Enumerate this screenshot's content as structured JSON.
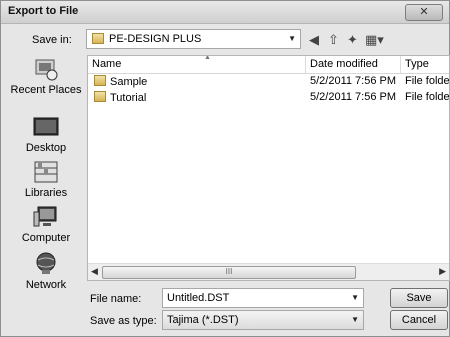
{
  "window": {
    "title": "Export to File",
    "close_label": "✕"
  },
  "toolbar": {
    "save_in_label": "Save in:",
    "save_in_value": "PE-DESIGN PLUS",
    "icons": [
      "back-icon",
      "up-folder-icon",
      "new-folder-icon",
      "view-menu-icon"
    ]
  },
  "places": [
    {
      "label": "Recent Places",
      "icon": "recent-places-icon"
    },
    {
      "label": "Desktop",
      "icon": "desktop-icon"
    },
    {
      "label": "Libraries",
      "icon": "libraries-icon"
    },
    {
      "label": "Computer",
      "icon": "computer-icon"
    },
    {
      "label": "Network",
      "icon": "network-icon"
    }
  ],
  "file_list": {
    "columns": [
      "Name",
      "Date modified",
      "Type"
    ],
    "rows": [
      {
        "name": "Sample",
        "date": "5/2/2011 7:56 PM",
        "type": "File folder"
      },
      {
        "name": "Tutorial",
        "date": "5/2/2011 7:56 PM",
        "type": "File folder"
      }
    ],
    "scroll_grip": "III"
  },
  "form": {
    "file_name_label": "File name:",
    "file_name_value": "Untitled.DST",
    "save_type_label": "Save as type:",
    "save_type_value": "Tajima (*.DST)"
  },
  "buttons": {
    "save": "Save",
    "cancel": "Cancel"
  }
}
